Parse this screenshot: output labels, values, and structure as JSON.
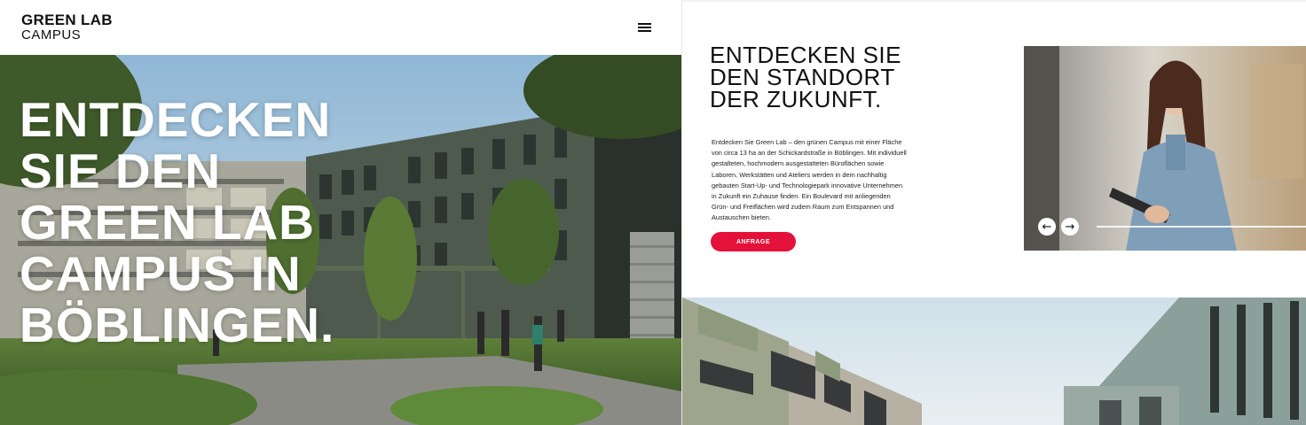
{
  "left": {
    "logo": {
      "line1": "GREEN LAB",
      "line2": "CAMPUS"
    },
    "menu_icon": "hamburger-menu-icon",
    "hero": {
      "title": "ENTDECKEN\nSIE DEN\nGREEN LAB\nCAMPUS IN\nBÖBLINGEN."
    }
  },
  "right": {
    "title": "ENTDECKEN SIE\nDEN STANDORT\nDER ZUKUNFT.",
    "body": "Entdecken Sie Green Lab – den grünen Campus mit einer Fläche von circa 13 ha an der Schickardstraße in Böblingen. Mit individuell gestalteten, hochmodern ausgestatteten Büroflächen sowie Laboren, Werkstätten und Ateliers werden in dem nachhaltig gebauten Start-Up- und Technologiepark innovative Unternehmen in Zukunft ein Zuhause finden. Ein Boulevard mit anliegenden Grün- und Freiflächen wird zudem Raum zum Entspannen und Austauschen bieten.",
    "cta_label": "ANFRAGE",
    "slider": {
      "prev_icon": "arrow-left-icon",
      "next_icon": "arrow-right-icon",
      "prev_glyph": "←",
      "next_glyph": "→"
    }
  },
  "colors": {
    "accent": "#e4123a",
    "text": "#111111",
    "background": "#ffffff"
  }
}
